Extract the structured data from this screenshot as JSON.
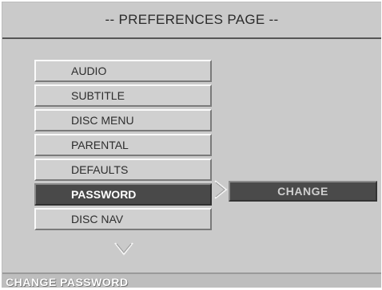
{
  "header": {
    "title": "-- PREFERENCES PAGE --"
  },
  "menu": {
    "items": [
      {
        "label": "AUDIO"
      },
      {
        "label": "SUBTITLE"
      },
      {
        "label": "DISC MENU"
      },
      {
        "label": "PARENTAL"
      },
      {
        "label": "DEFAULTS"
      },
      {
        "label": "PASSWORD",
        "selected": true
      },
      {
        "label": "DISC NAV"
      }
    ]
  },
  "submenu": {
    "label": "CHANGE"
  },
  "icons": {
    "submenu_arrow": "chevron-right-icon",
    "scroll_arrow": "chevron-down-icon"
  },
  "status": {
    "text": "CHANGE PASSWORD"
  },
  "colors": {
    "selected_fill": "#595959",
    "background": "#dedede"
  }
}
